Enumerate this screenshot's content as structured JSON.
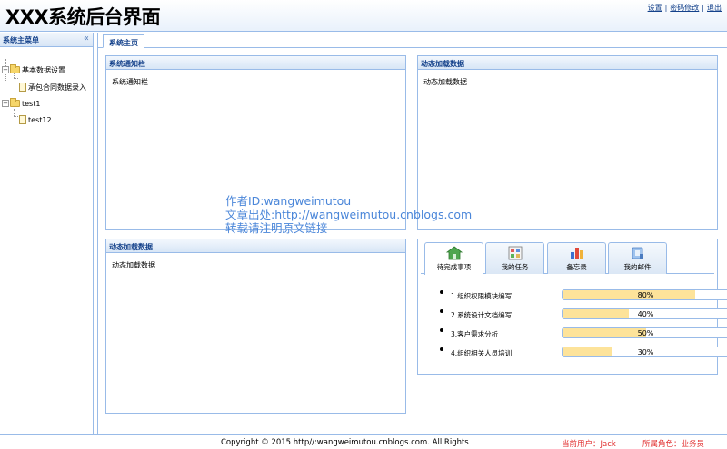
{
  "header": {
    "title": "XXX系统后台界面",
    "links": [
      "设置",
      "密码修改",
      "退出"
    ],
    "separator": "|"
  },
  "sidebar": {
    "title": "系统主菜单",
    "collapse_icon": "«",
    "tree": [
      {
        "label": "基本数据设置",
        "toggle": "−",
        "children": [
          "承包合同数据录入"
        ]
      },
      {
        "label": "test1",
        "toggle": "−",
        "children": [
          "test12"
        ]
      }
    ]
  },
  "main": {
    "tab": "系统主页",
    "panels": {
      "notice": {
        "title": "系统通知栏",
        "body": "系统通知栏"
      },
      "dynamic1": {
        "title": "动态加载数据",
        "body": "动态加载数据"
      },
      "dynamic2": {
        "title": "动态加载数据",
        "body": "动态加载数据"
      }
    },
    "task_tabs": [
      "待完成事项",
      "我的任务",
      "备忘录",
      "我的邮件"
    ],
    "tasks": [
      {
        "name": "1.组织权限模块编写",
        "progress": 80,
        "label": "80%"
      },
      {
        "name": "2.系统设计文档编写",
        "progress": 40,
        "label": "40%"
      },
      {
        "name": "3.客户需求分析",
        "progress": 50,
        "label": "50%"
      },
      {
        "name": "4.组织相关人员培训",
        "progress": 30,
        "label": "30%"
      }
    ]
  },
  "watermark": [
    "作者ID:wangweimutou",
    "文章出处:http://wangweimutou.cnblogs.com",
    "转载请注明原文链接"
  ],
  "footer": {
    "copyright": "Copyright © 2015 http//:wangweimutou.cnblogs.com. All Rights",
    "current_user": "当前用户：Jack",
    "current_role": "所属角色：业务员"
  },
  "colors": {
    "border": "#99bbe8",
    "header_text": "#15428b",
    "progress_fill": "#fde39a",
    "footer_red": "#e02a2a",
    "watermark": "#4a86d9"
  }
}
